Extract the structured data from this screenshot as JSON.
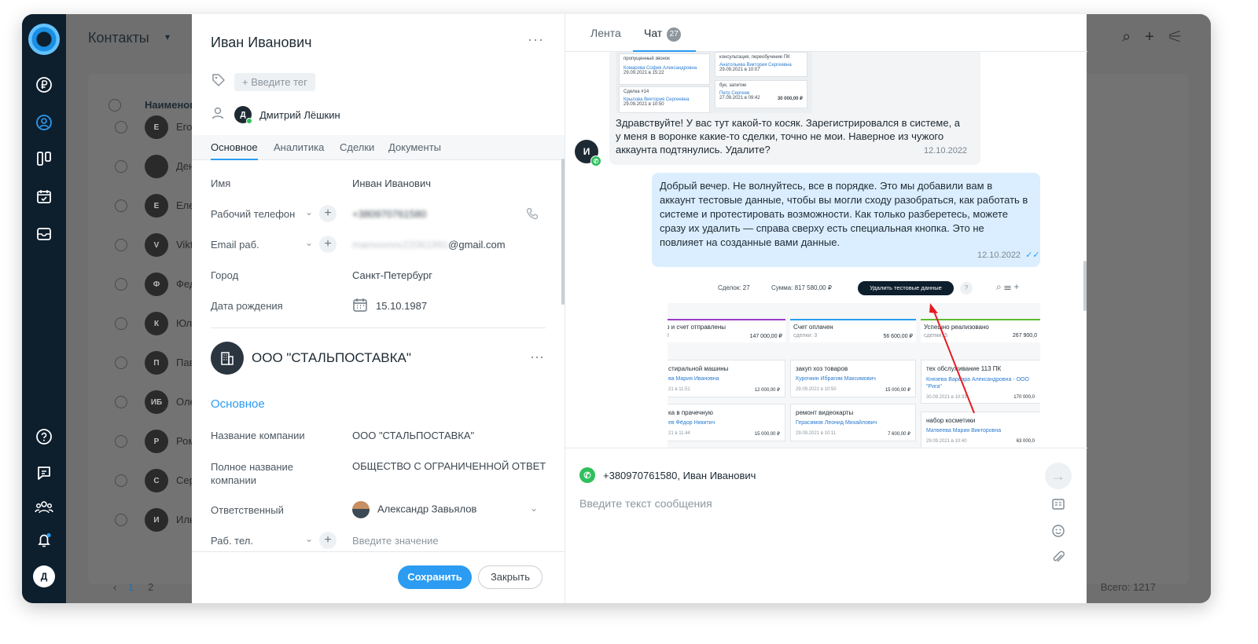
{
  "sidebar": {
    "avatar_letter": "Д"
  },
  "background": {
    "title": "Контакты",
    "column_header": "Наименов",
    "rows": [
      {
        "initial": "Е",
        "name": "Его"
      },
      {
        "initial": "",
        "name": "Ден"
      },
      {
        "initial": "Е",
        "name": "Еле"
      },
      {
        "initial": "V",
        "name": "Vikt"
      },
      {
        "initial": "Ф",
        "name": "Фед"
      },
      {
        "initial": "К",
        "name": "Юли"
      },
      {
        "initial": "П",
        "name": "Пав"
      },
      {
        "initial": "ИБ",
        "name": "Оле"
      },
      {
        "initial": "Р",
        "name": "Ром"
      },
      {
        "initial": "С",
        "name": "Сер"
      },
      {
        "initial": "И",
        "name": "Иль"
      }
    ],
    "page_current": "1",
    "page_next": "2",
    "total": "Всего: 1217"
  },
  "contact": {
    "name": "Иван Иванович",
    "tag_placeholder": "+ Введите тег",
    "owner_initial": "Д",
    "owner_name": "Дмитрий Лёшкин",
    "tabs": [
      "Основное",
      "Аналитика",
      "Сделки",
      "Документы"
    ],
    "fields": {
      "name_label": "Имя",
      "name_value": "Инван Иванович",
      "phone_label": "Рабочий телефон",
      "phone_value": "+380970761580",
      "email_label": "Email раб.",
      "email_value_hidden": "mamoonov22061991",
      "email_value_domain": "@gmail.com",
      "city_label": "Город",
      "city_value": "Санкт-Петербург",
      "birthday_label": "Дата рождения",
      "birthday_value": "15.10.1987"
    },
    "company": {
      "name": "ООО \"СТАЛЬПОСТАВКА\"",
      "section": "Основное",
      "name_label": "Название компании",
      "name_value": "ООО \"СТАЛЬПОСТАВКА\"",
      "full_label": "Полное название компании",
      "full_value": "ОБЩЕСТВО С ОГРАНИЧЕННОЙ ОТВЕТ",
      "resp_label": "Ответственный",
      "resp_value": "Александр Завьялов",
      "phone_label": "Раб. тел.",
      "phone_placeholder": "Введите значение"
    },
    "save_label": "Сохранить",
    "close_label": "Закрыть"
  },
  "chat": {
    "tab_feed": "Лента",
    "tab_chat": "Чат",
    "chat_badge": "27",
    "incoming": {
      "avatar": "И",
      "text": "Здравствуйте! У вас тут какой-то косяк. Зарегистрировался в системе, а у меня в воронке какие-то сделки, точно не мои. Наверное из чужого аккаунта подтянулись. Удалите?",
      "time": "12.10.2022",
      "thumb_cards": [
        {
          "title": "пропущенный звонок",
          "person": "Комарова София Александровна",
          "date": "29.09.2021 в 15:22"
        },
        {
          "title": "консультация, переобучение ПК",
          "person": "Анатольева Виктория Сергеевна",
          "date": "29.09.2021 в 10:07"
        },
        {
          "title": "Сделка #14",
          "person": "Крылова Виктория Сергеевна",
          "date": "29.09.2021 в 10:50"
        },
        {
          "title": "бук, запитие",
          "person": "Петр Сергеев",
          "date": "27.09.2021 в 09:42",
          "amount": "30 000,00 ₽"
        }
      ]
    },
    "outgoing": {
      "text": "Добрый вечер. Не волнуйтесь, все в порядке. Это мы добавили вам в аккаунт тестовые данные, чтобы вы могли сходу разобраться, как работать в системе и протестировать возможности. Как только разберетесь, можете сразу их удалить — справа сверху есть специальная кнопка. Это не повлияет на созданные вами данные.",
      "time": "12.10.2022"
    },
    "screenshot": {
      "deals": "Сделок: 27",
      "sum": "Сумма: 817 580,00 ₽",
      "delete_btn": "Удалить тестовые данные",
      "columns": [
        {
          "title": "р и счет отправлены",
          "sub": "3",
          "value": "147 000,00 ₽"
        },
        {
          "title": "Счет оплачен",
          "sub": "сделки: 3",
          "value": "56 600,00 ₽"
        },
        {
          "title": "Успешно реализовано",
          "sub": "сделки: 5",
          "value": "267 900,0"
        }
      ],
      "cards": [
        {
          "title": "стиральной машины",
          "person": "ва Мария Ивановна",
          "date": "21 в 11:51",
          "amount": "12 000,00 ₽"
        },
        {
          "title": "закуп хоз товаров",
          "person": "Курочкин Ибрагим Максимович",
          "date": "29.09.2021 в 10:50",
          "amount": "15 000,00 ₽"
        },
        {
          "title": "тех обслуживание 113 ПК",
          "person": "Князева Варвара Александровна - ООО \"Рига\"",
          "date": "30.09.2021 в 10:33",
          "amount": "170 000,0"
        },
        {
          "title": "ка в прачечную",
          "person": "ев Фёдор Никитич",
          "date": "21 в 11:44",
          "amount": "15 000,00 ₽"
        },
        {
          "title": "ремонт видеокарты",
          "person": "Герасимов Леонид Михайлович",
          "date": "29.09.2021 в 10:11",
          "amount": "7 600,00 ₽"
        },
        {
          "title": "набор косметики",
          "person": "Матвеева Мария Викторовна",
          "date": "29.09.2021 в 10:40",
          "amount": "63 000,0"
        }
      ]
    },
    "composer": {
      "contact": "+380970761580, Иван Иванович",
      "placeholder": "Введите текст сообщения"
    }
  }
}
